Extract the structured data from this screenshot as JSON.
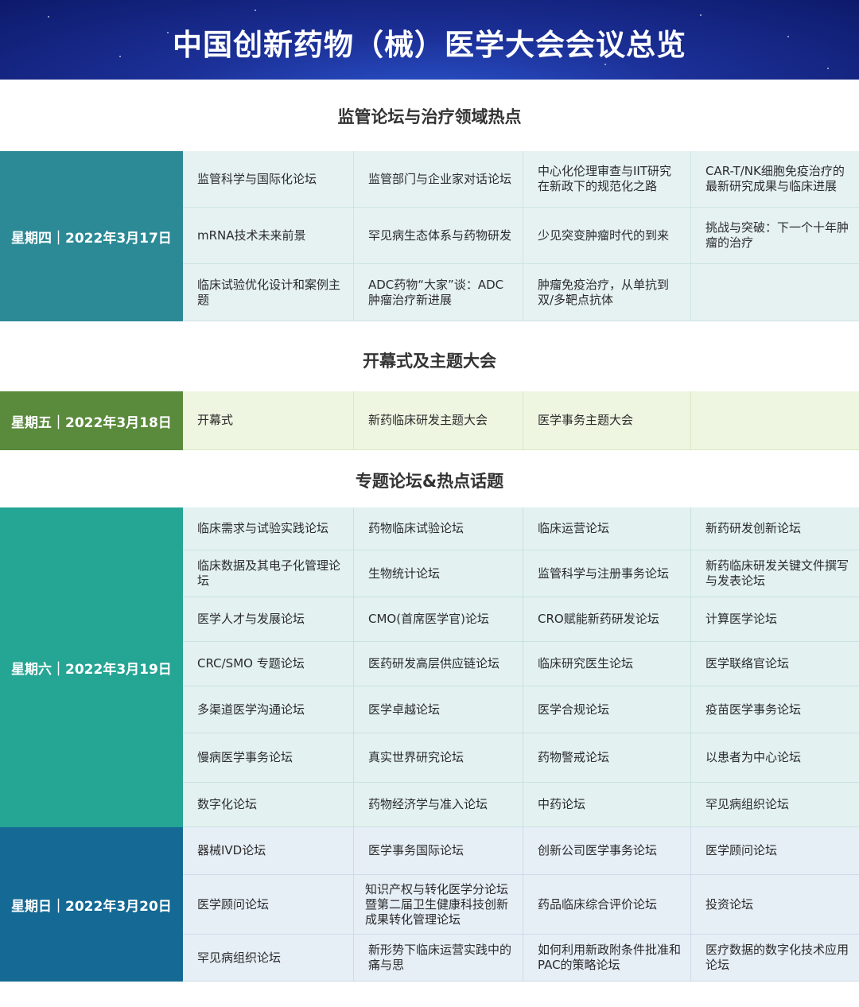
{
  "banner": {
    "title": "中国创新药物（械）医学大会会议总览"
  },
  "sections": [
    {
      "heading": "监管论坛与治疗领域热点",
      "day": "星期四｜2022年3月17日",
      "color": "#2b8a96",
      "rows": [
        [
          "监管科学与国际化论坛",
          "监管部门与企业家对话论坛",
          "中心化伦理审查与IIT研究在新政下的规范化之路",
          "CAR-T/NK细胞免疫治疗的最新研究成果与临床进展"
        ],
        [
          "mRNA技术未来前景",
          "罕见病生态体系与药物研发",
          "少见突变肿瘤时代的到来",
          "挑战与突破：下一个十年肿瘤的治疗"
        ],
        [
          "临床试验优化设计和案例主题",
          "ADC药物“大家”谈：ADC肿瘤治疗新进展",
          "肿瘤免疫治疗，从单抗到双/多靶点抗体",
          ""
        ]
      ]
    },
    {
      "heading": "开幕式及主题大会",
      "day": "星期五｜2022年3月18日",
      "color": "#5a8a3c",
      "rows": [
        [
          "开幕式",
          "新药临床研发主题大会",
          "医学事务主题大会",
          ""
        ]
      ]
    },
    {
      "heading": "专题论坛&热点话题",
      "day": "星期六｜2022年3月19日",
      "color": "#25a594",
      "rows": [
        [
          "临床需求与试验实践论坛",
          "药物临床试验论坛",
          "临床运营论坛",
          "新药研发创新论坛"
        ],
        [
          "临床数据及其电子化管理论坛",
          "生物统计论坛",
          "监管科学与注册事务论坛",
          "新药临床研发关键文件撰写与发表论坛"
        ],
        [
          "医学人才与发展论坛",
          "CMO(首席医学官)论坛",
          "CRO赋能新药研发论坛",
          "计算医学论坛"
        ],
        [
          "CRC/SMO 专题论坛",
          "医药研发高层供应链论坛",
          "临床研究医生论坛",
          "医学联络官论坛"
        ],
        [
          "多渠道医学沟通论坛",
          "医学卓越论坛",
          "医学合规论坛",
          "疫苗医学事务论坛"
        ],
        [
          "慢病医学事务论坛",
          "真实世界研究论坛",
          "药物警戒论坛",
          "以患者为中心论坛"
        ],
        [
          "数字化论坛",
          "药物经济学与准入论坛",
          "中药论坛",
          "罕见病组织论坛"
        ]
      ]
    },
    {
      "heading": "",
      "day": "星期日｜2022年3月20日",
      "color": "#146a94",
      "rows": [
        [
          "器械IVD论坛",
          "医学事务国际论坛",
          "创新公司医学事务论坛",
          "医学顾问论坛"
        ],
        [
          "医学顾问论坛",
          "知识产权与转化医学分论坛暨第二届卫生健康科技创新成果转化管理论坛",
          "药品临床综合评价论坛",
          "投资论坛"
        ],
        [
          "罕见病组织论坛",
          "新形势下临床运营实践中的痛与思",
          "如何利用新政附条件批准和PAC的策略论坛",
          "医疗数据的数字化技术应用论坛"
        ]
      ]
    }
  ]
}
